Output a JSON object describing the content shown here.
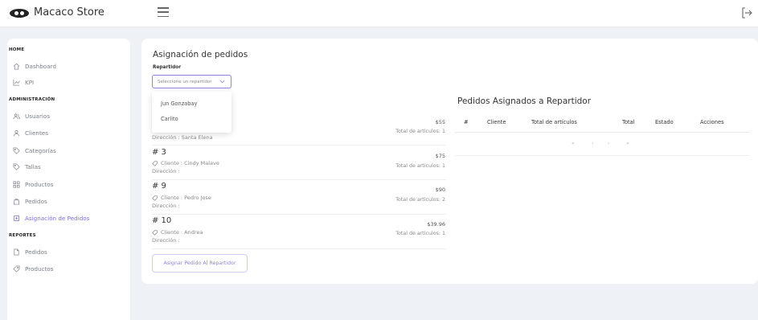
{
  "app": {
    "brand_name": "Macaco Store"
  },
  "sidebar": {
    "sections": [
      {
        "title": "HOME",
        "items": [
          {
            "label": "Dashboard"
          },
          {
            "label": "KPI"
          }
        ]
      },
      {
        "title": "ADMINISTRACIÓN",
        "items": [
          {
            "label": "Usuarios"
          },
          {
            "label": "Clientes"
          },
          {
            "label": "Categorías"
          },
          {
            "label": "Tallas"
          },
          {
            "label": "Productos"
          },
          {
            "label": "Pedidos"
          },
          {
            "label": "Asignación de Pedidos",
            "active": true
          }
        ]
      },
      {
        "title": "REPORTES",
        "items": [
          {
            "label": "Pedidos"
          },
          {
            "label": "Productos"
          }
        ]
      }
    ],
    "active_color": "#7e6fd8"
  },
  "assignment": {
    "title": "Asignación de pedidos",
    "repartidor_label": "Repartidor",
    "select_placeholder": "Seleccione un repartidor",
    "dropdown_options": [
      "Jun Gonzabay",
      "Carlito"
    ],
    "orders": [
      {
        "address": "Dirección : Santa Elena",
        "price": "$55",
        "articles": "Total de articulos: 1"
      },
      {
        "id": "# 3",
        "client": "Cliente : Cindy Malave",
        "address": "Dirección :",
        "price": "$75",
        "articles": "Total de articulos: 1"
      },
      {
        "id": "# 9",
        "client": "Cliente : Pedro Jose",
        "address": "Dirección :",
        "price": "$90",
        "articles": "Total de articulos: 2"
      },
      {
        "id": "# 10",
        "client": "Cliente : Andrea",
        "address": "Dirección :",
        "price": "$39.96",
        "articles": "Total de articulos: 1"
      }
    ],
    "assign_button": "Asignar Pedido Al Repartidor"
  },
  "assigned": {
    "title": "Pedidos Asignados a Repartidor",
    "columns": [
      "#",
      "Cliente",
      "Total de artículos",
      "Total",
      "Estado",
      "Acciones"
    ],
    "pager": [
      "«",
      "‹",
      "›",
      "»"
    ]
  },
  "colors": {
    "accent": "#8f84e2",
    "background": "#eef1f6"
  }
}
